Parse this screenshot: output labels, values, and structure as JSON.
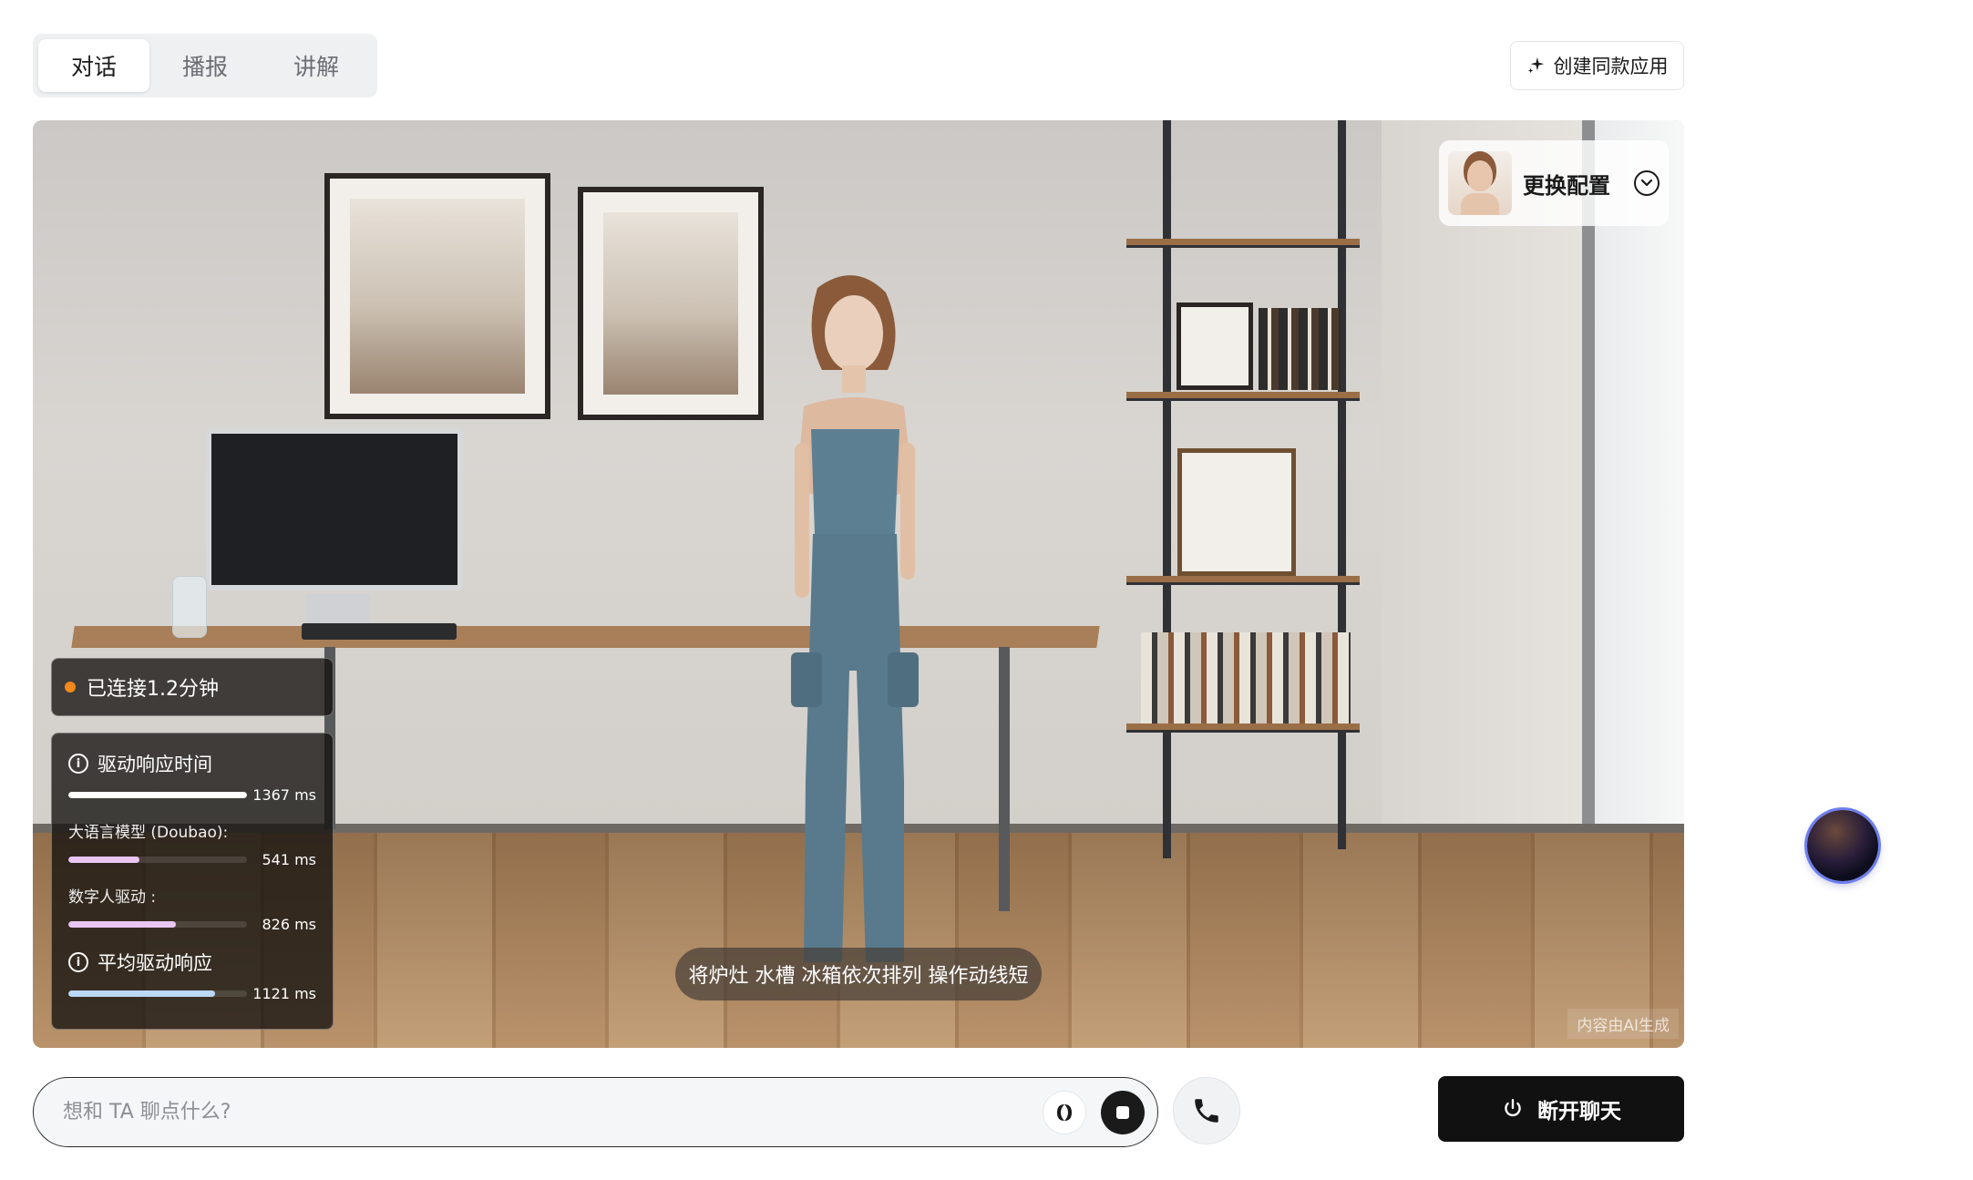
{
  "tabs": [
    {
      "label": "对话",
      "active": true
    },
    {
      "label": "播报",
      "active": false
    },
    {
      "label": "讲解",
      "active": false
    }
  ],
  "header": {
    "create_button_label": "创建同款应用",
    "create_icon": "sparkle-icon"
  },
  "stage": {
    "config_label": "更换配置",
    "subtitle": "将炉灶 水槽 冰箱依次排列 操作动线短",
    "watermark": "内容由AI生成"
  },
  "connection": {
    "status_text": "已连接1.2分钟",
    "status_color": "#f08a1a"
  },
  "stats": {
    "drive_response": {
      "label": "驱动响应时间",
      "value": "1367 ms",
      "ms": 1367,
      "color": "#ffffff"
    },
    "llm": {
      "label": "大语言模型 (Doubao):",
      "value": "541 ms",
      "ms": 541,
      "color": "#e9c6f2"
    },
    "avatar_drive": {
      "label": "数字人驱动 :",
      "value": "826 ms",
      "ms": 826,
      "color": "#e9c6f2"
    },
    "avg_drive": {
      "label": "平均驱动响应",
      "value": "1121 ms",
      "ms": 1121,
      "color": "#bcd8f7"
    },
    "scale_max_ms": 1367
  },
  "input": {
    "placeholder": "想和 TA 聊点什么?",
    "value": ""
  },
  "actions": {
    "disconnect_label": "断开聊天"
  },
  "colors": {
    "accent_dark": "#111111",
    "tab_bg": "#eef0f2"
  }
}
